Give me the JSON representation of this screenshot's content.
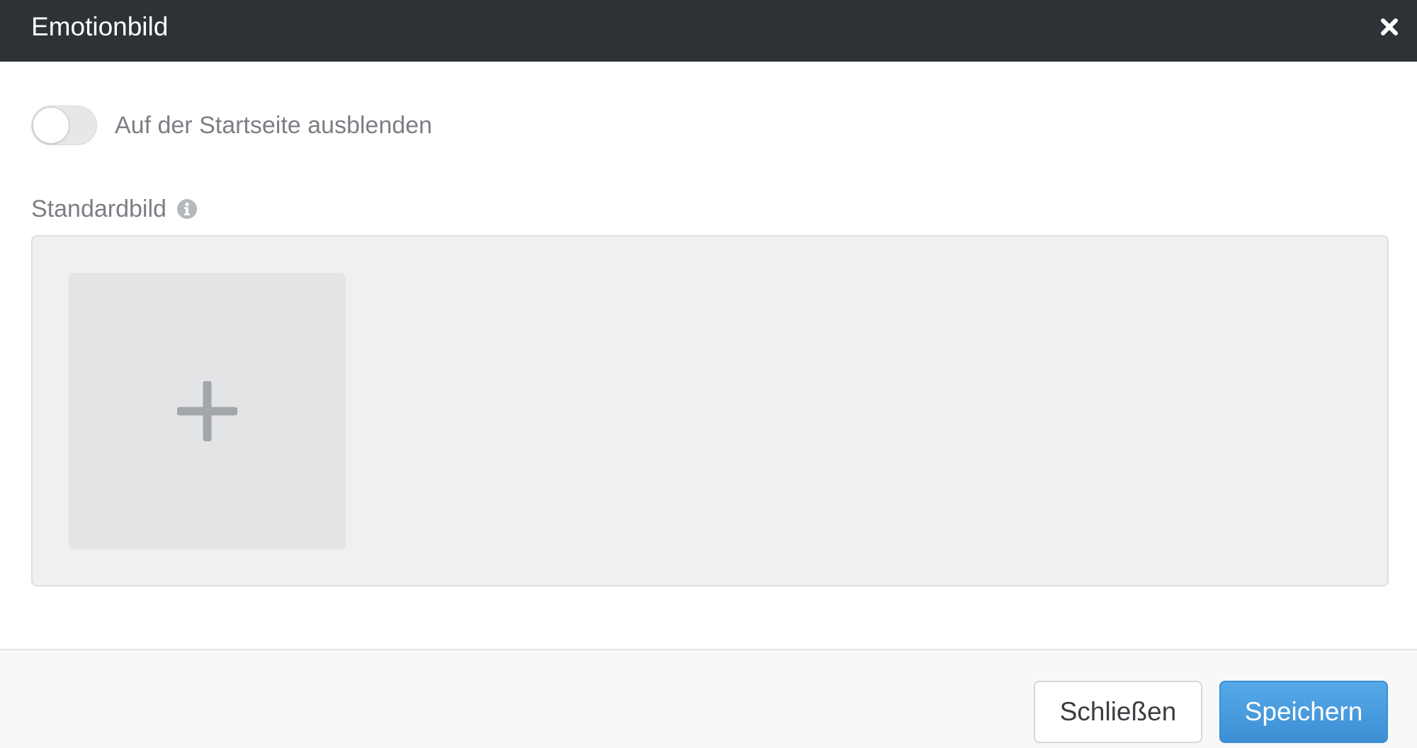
{
  "dialog": {
    "title": "Emotionbild",
    "close_icon": "close-icon"
  },
  "body": {
    "toggle": {
      "label": "Auf der Startseite ausblenden",
      "checked": false
    },
    "image_field": {
      "label": "Standardbild",
      "info_icon": "info-icon",
      "add_icon": "plus-icon"
    }
  },
  "footer": {
    "close_label": "Schließen",
    "save_label": "Speichern"
  },
  "colors": {
    "header_bg": "#2e3236",
    "primary": "#4a9de0",
    "muted_text": "#7b7f84"
  }
}
